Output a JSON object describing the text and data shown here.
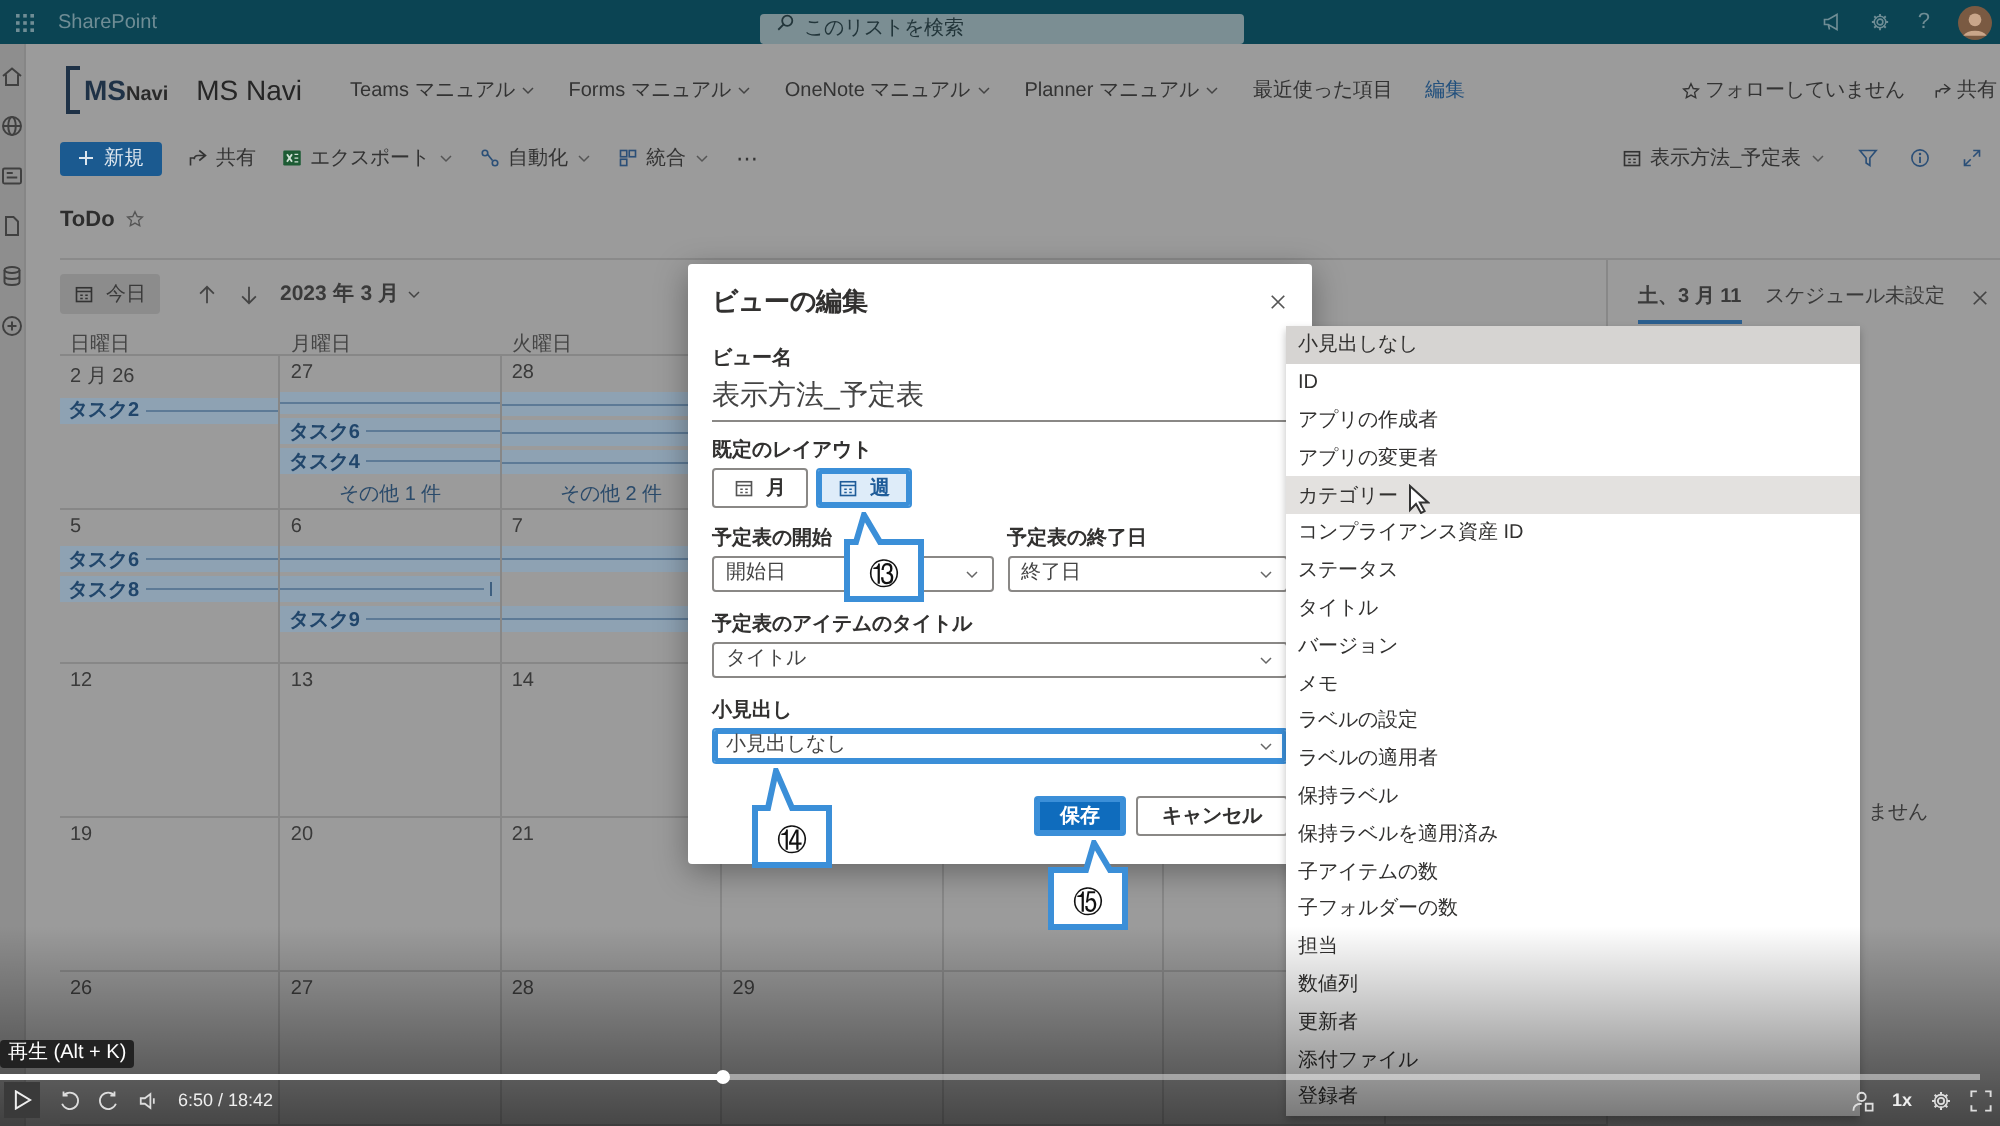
{
  "top_bar": {
    "app_name": "SharePoint",
    "search": {
      "placeholder": "このリストを検索"
    },
    "help": "?"
  },
  "site_header": {
    "logo": {
      "initials": "MS",
      "name": "Navi"
    },
    "site_name": "MS Navi",
    "nav": [
      {
        "label": "Teams マニュアル",
        "kind": "menu"
      },
      {
        "label": "Forms マニュアル",
        "kind": "menu"
      },
      {
        "label": "OneNote マニュアル",
        "kind": "menu"
      },
      {
        "label": "Planner マニュアル",
        "kind": "menu"
      },
      {
        "label": "最近使った項目",
        "kind": "plain"
      },
      {
        "label": "編集",
        "kind": "link"
      }
    ],
    "follow": "フォローしていません",
    "share": "共有"
  },
  "command_bar": {
    "new": "新規",
    "items": [
      {
        "label": "共有",
        "has_menu": false
      },
      {
        "label": "エクスポート",
        "has_menu": true
      },
      {
        "label": "自動化",
        "has_menu": true
      },
      {
        "label": "統合",
        "has_menu": true
      }
    ],
    "more": "⋯",
    "view_name": "表示方法_予定表"
  },
  "list_title": "ToDo",
  "calendar": {
    "today": "今日",
    "month_label": "2023 年 3 月",
    "weekdays": [
      "日曜日",
      "月曜日",
      "火曜日"
    ],
    "weeks": [
      {
        "dates": [
          {
            "date": "2 月 26",
            "bars": [
              {
                "kind": "start",
                "label": "タスク2"
              }
            ]
          },
          {
            "date": "27",
            "bars": [
              {
                "kind": "middle"
              },
              {
                "kind": "start",
                "label": "タスク6"
              },
              {
                "kind": "start",
                "label": "タスク4"
              }
            ],
            "more": "その他 1 件"
          },
          {
            "date": "28",
            "bars": [
              {
                "kind": "middle"
              },
              {
                "kind": "middle"
              },
              {
                "kind": "middle"
              }
            ],
            "more": "その他 2 件"
          }
        ]
      },
      {
        "dates": [
          {
            "date": "5",
            "bars": [
              {
                "kind": "start",
                "label": "タスク6"
              },
              {
                "kind": "start",
                "label": "タスク8"
              }
            ]
          },
          {
            "date": "6",
            "bars": [
              {
                "kind": "middle"
              },
              {
                "kind": "end"
              },
              {
                "kind": "start",
                "label": "タスク9"
              }
            ]
          },
          {
            "date": "7",
            "bars": [
              {
                "kind": "middle"
              },
              {
                "kind": "none"
              },
              {
                "kind": "middle"
              }
            ]
          }
        ]
      },
      {
        "dates": [
          {
            "date": "12"
          },
          {
            "date": "13"
          },
          {
            "date": "14"
          }
        ]
      },
      {
        "dates": [
          {
            "date": "19"
          },
          {
            "date": "20"
          },
          {
            "date": "21"
          }
        ]
      },
      {
        "dates": [
          {
            "date": "26"
          },
          {
            "date": "27"
          },
          {
            "date": "28"
          },
          {
            "date": "29"
          }
        ]
      }
    ]
  },
  "side_pane": {
    "tabs": [
      {
        "label": "土、3 月 11",
        "selected": true
      },
      {
        "label": "スケジュール未設定",
        "selected": false
      }
    ],
    "message": "ません"
  },
  "dialog": {
    "title": "ビューの編集",
    "view_name": {
      "label": "ビュー名",
      "value": "表示方法_予定表"
    },
    "layout": {
      "label": "既定のレイアウト",
      "options": [
        {
          "label": "月",
          "selected": false,
          "highlighted": false
        },
        {
          "label": "週",
          "selected": true,
          "highlighted": true
        }
      ]
    },
    "start": {
      "label": "予定表の開始",
      "value": "開始日"
    },
    "end": {
      "label": "予定表の終了日",
      "value": "終了日"
    },
    "item_title": {
      "label": "予定表のアイテムのタイトル",
      "value": "タイトル",
      "highlighted": false
    },
    "subheading": {
      "label": "小見出し",
      "value": "小見出しなし",
      "highlighted": true
    },
    "buttons": [
      {
        "label": "保存",
        "kind": "primary",
        "highlighted": true
      },
      {
        "label": "キャンセル",
        "kind": "secondary",
        "highlighted": false
      }
    ]
  },
  "dropdown": {
    "options": [
      {
        "label": "小見出しなし",
        "selected": true,
        "hovered": false
      },
      {
        "label": "ID",
        "selected": false,
        "hovered": false
      },
      {
        "label": "アプリの作成者",
        "selected": false,
        "hovered": false
      },
      {
        "label": "アプリの変更者",
        "selected": false,
        "hovered": false
      },
      {
        "label": "カテゴリー",
        "selected": false,
        "hovered": true
      },
      {
        "label": "コンプライアンス資産 ID",
        "selected": false,
        "hovered": false
      },
      {
        "label": "ステータス",
        "selected": false,
        "hovered": false
      },
      {
        "label": "タイトル",
        "selected": false,
        "hovered": false
      },
      {
        "label": "バージョン",
        "selected": false,
        "hovered": false
      },
      {
        "label": "メモ",
        "selected": false,
        "hovered": false
      },
      {
        "label": "ラベルの設定",
        "selected": false,
        "hovered": false
      },
      {
        "label": "ラベルの適用者",
        "selected": false,
        "hovered": false
      },
      {
        "label": "保持ラベル",
        "selected": false,
        "hovered": false
      },
      {
        "label": "保持ラベルを適用済み",
        "selected": false,
        "hovered": false
      },
      {
        "label": "子アイテムの数",
        "selected": false,
        "hovered": false
      },
      {
        "label": "子フォルダーの数",
        "selected": false,
        "hovered": false
      },
      {
        "label": "担当",
        "selected": false,
        "hovered": false
      },
      {
        "label": "数値列",
        "selected": false,
        "hovered": false
      },
      {
        "label": "更新者",
        "selected": false,
        "hovered": false
      },
      {
        "label": "添付ファイル",
        "selected": false,
        "hovered": false
      },
      {
        "label": "登録者",
        "selected": false,
        "hovered": false
      }
    ]
  },
  "callouts": [
    {
      "label": "⑬"
    },
    {
      "label": "⑭"
    },
    {
      "label": "⑮"
    }
  ],
  "player": {
    "tooltip": "再生 (Alt + K)",
    "time": "6:50 / 18:42",
    "level": 0.365,
    "speed": "1x"
  }
}
